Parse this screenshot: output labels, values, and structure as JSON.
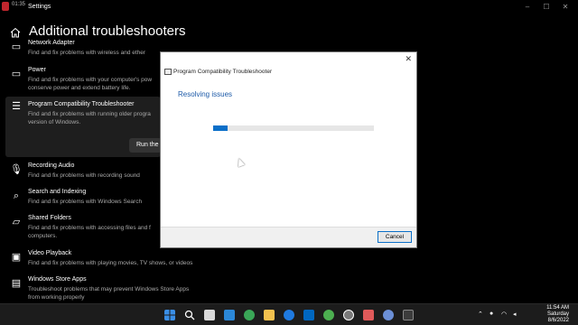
{
  "window": {
    "app_name": "Settings",
    "tray_time": "01:35",
    "controls": {
      "minimize": "–",
      "maximize": "☐",
      "close": "✕"
    }
  },
  "page": {
    "title": "Additional troubleshooters"
  },
  "items": [
    {
      "title": "Network Adapter",
      "desc": [
        "Find and fix problems with wireless and ether"
      ],
      "icon": "monitor-icon"
    },
    {
      "title": "Power",
      "desc": [
        "Find and fix problems with your computer's pow",
        "conserve power and extend battery life."
      ],
      "icon": "battery-icon"
    },
    {
      "title": "Program Compatibility Troubleshooter",
      "desc": [
        "Find and fix problems with running older progra",
        "version of Windows."
      ],
      "icon": "list-icon",
      "run_label": "Run the"
    },
    {
      "title": "Recording Audio",
      "desc": [
        "Find and fix problems with recording sound"
      ],
      "icon": "microphone-icon"
    },
    {
      "title": "Search and Indexing",
      "desc": [
        "Find and fix problems with Windows Search"
      ],
      "icon": "search-icon"
    },
    {
      "title": "Shared Folders",
      "desc": [
        "Find and fix problems with accessing files and f",
        "computers."
      ],
      "icon": "folder-icon"
    },
    {
      "title": "Video Playback",
      "desc": [
        "Find and fix problems with playing movies, TV shows, or videos"
      ],
      "icon": "video-icon"
    },
    {
      "title": "Windows Store Apps",
      "desc": [
        "Troubleshoot problems that may prevent Windows Store Apps",
        "from working properly"
      ],
      "icon": "store-icon"
    }
  ],
  "dialog": {
    "title": "Program Compatibility Troubleshooter",
    "status": "Resolving issues",
    "progress": 0.09,
    "cancel_label": "Cancel",
    "close_glyph": "✕"
  },
  "taskbar": {
    "time": "11:54 AM",
    "day": "Saturday",
    "date": "8/6/2022",
    "colors": {
      "accent": "#0b6fc8",
      "status_text": "#1c5aa8"
    }
  }
}
